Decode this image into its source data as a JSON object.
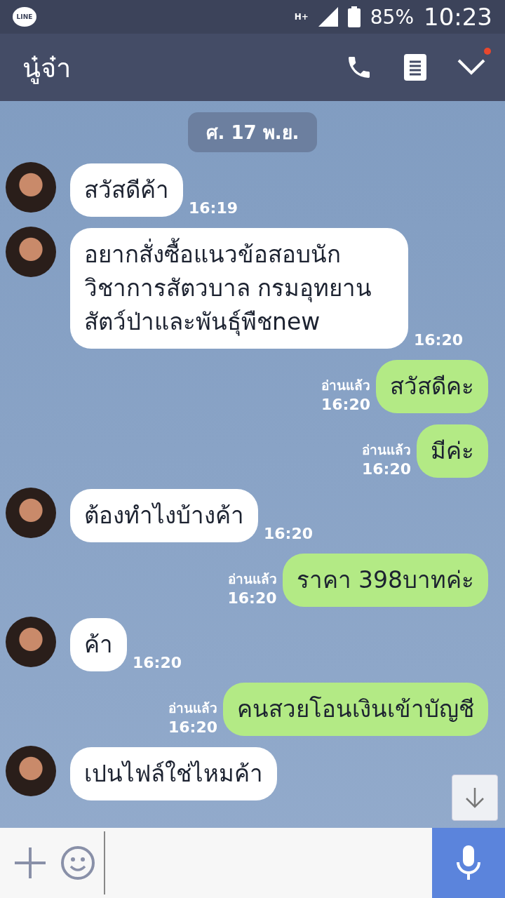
{
  "status_bar": {
    "app_badge": "LINE",
    "network": "H+",
    "battery": "85%",
    "time": "10:23"
  },
  "header": {
    "title": "นู๋จ๋า",
    "notification": true
  },
  "date_chip": "ศ. 17 พ.ย.",
  "messages": [
    {
      "kind": "incoming",
      "text": "สวัสดีค้า",
      "time": "16:19"
    },
    {
      "kind": "incoming",
      "text": "อยากสั่งซื้อแนวข้อสอบนักวิชาการสัตวบาล กรมอุทยานสัตว์ป่าและพันธุ์พืชnew",
      "time": "16:20"
    },
    {
      "kind": "outgoing",
      "text": "สวัสดีคะ",
      "read": "อ่านแล้ว",
      "time": "16:20"
    },
    {
      "kind": "outgoing",
      "text": "มีค่ะ",
      "read": "อ่านแล้ว",
      "time": "16:20"
    },
    {
      "kind": "incoming",
      "text": "ต้องทำไงบ้างค้า",
      "time": "16:20"
    },
    {
      "kind": "outgoing",
      "text": "ราคา 398บาทค่ะ",
      "read": "อ่านแล้ว",
      "time": "16:20"
    },
    {
      "kind": "incoming",
      "text": "ค้า",
      "time": "16:20"
    },
    {
      "kind": "outgoing",
      "text": "คนสวยโอนเงินเข้าบัญชี",
      "read": "อ่านแล้ว",
      "time": "16:20"
    },
    {
      "kind": "incoming",
      "text": "เปนไฟล์ใช่ไหมค้า"
    }
  ]
}
